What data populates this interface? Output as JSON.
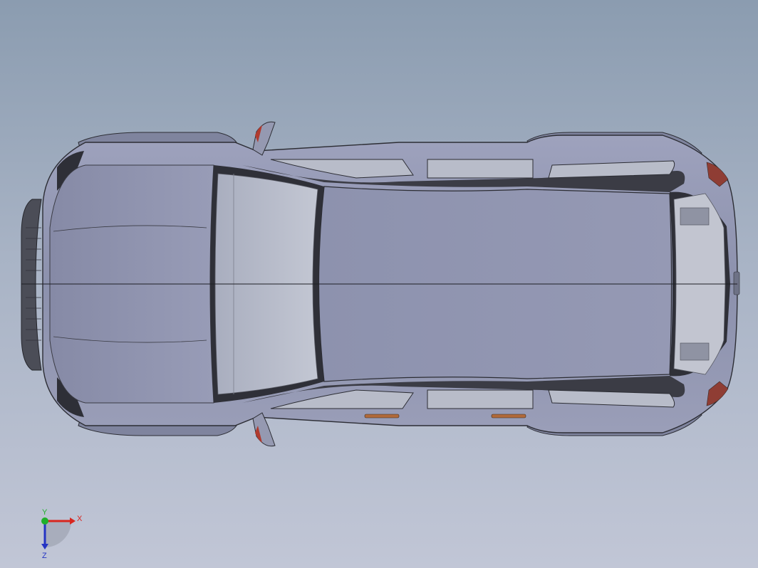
{
  "viewport": {
    "background_top": "#8b9cb0",
    "background_bottom": "#c1c6d6"
  },
  "model": {
    "name": "car-top-view",
    "body_color": "#9096b2",
    "glass_color": "#b4b9c8",
    "trim_color": "#3a3b44",
    "light_color": "#c0392b"
  },
  "triad": {
    "x_label": "X",
    "y_label": "Y",
    "z_label": "Z",
    "x_color": "#d8261f",
    "y_color": "#1fb02a",
    "z_color": "#2534c4"
  }
}
